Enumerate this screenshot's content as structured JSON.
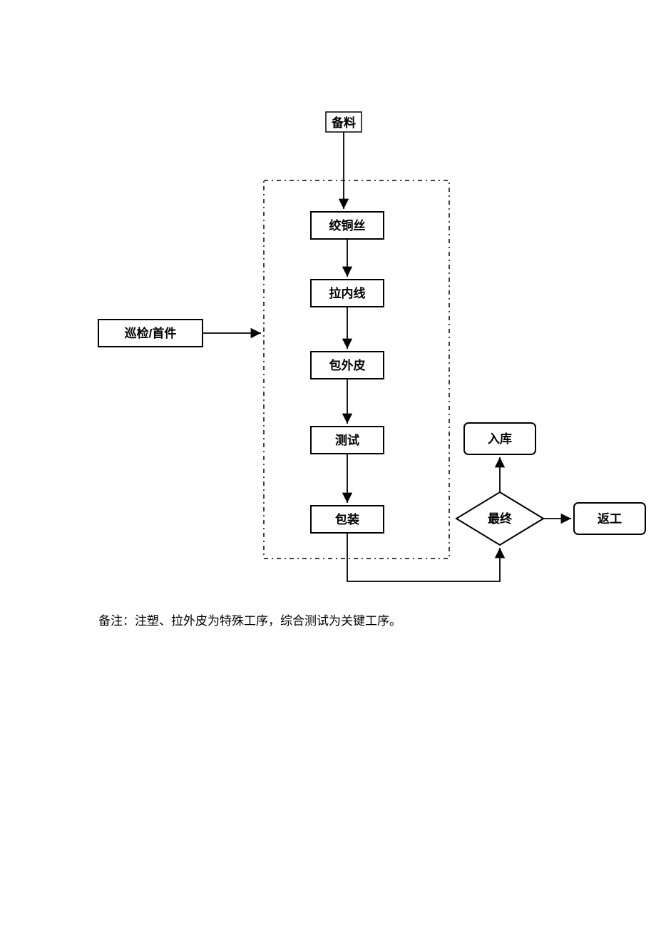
{
  "nodes": {
    "prep": "备料",
    "twist": "绞铜丝",
    "draw": "拉内线",
    "wrap": "包外皮",
    "test": "测试",
    "pack": "包装",
    "inspect": "巡检/首件",
    "store": "入库",
    "final": "最终",
    "rework": "返工"
  },
  "note": "备注：注塑、拉外皮为特殊工序，综合测试为关键工序。"
}
